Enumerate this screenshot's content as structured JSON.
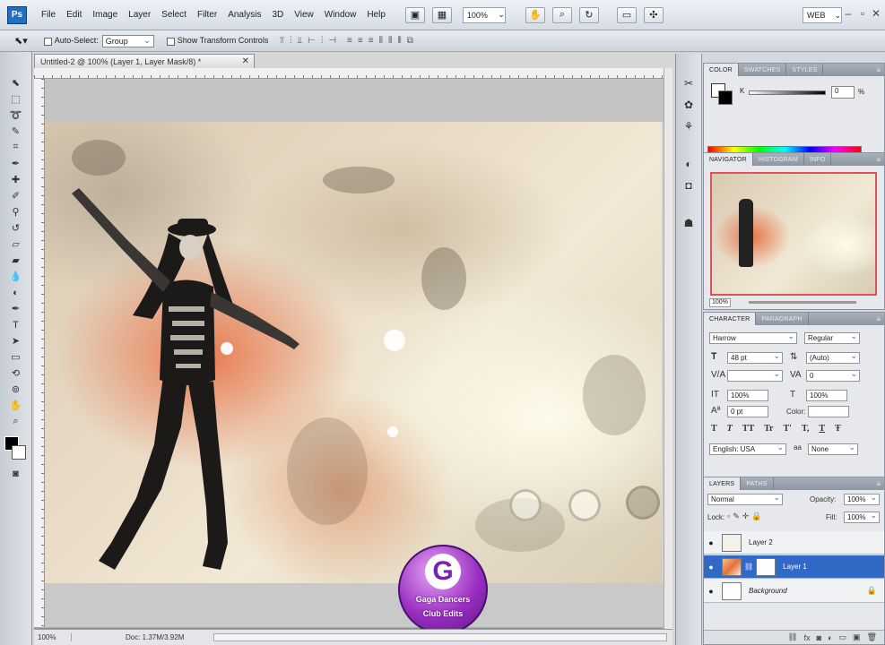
{
  "app": {
    "logo": "Ps",
    "menus": [
      "File",
      "Edit",
      "Image",
      "Layer",
      "Select",
      "Filter",
      "Analysis",
      "3D",
      "View",
      "Window",
      "Help"
    ],
    "zoom_select": "100%",
    "workspace": "WEB"
  },
  "options_bar": {
    "auto_select_label": "Auto-Select:",
    "auto_select_value": "Group",
    "show_transform_label": "Show Transform Controls"
  },
  "document": {
    "tab_title": "Untitled-2 @ 100% (Layer 1, Layer Mask/8) *",
    "status_zoom": "100%",
    "status_doc": "Doc: 1.37M/3.92M"
  },
  "watermark": {
    "letter": "G",
    "line1": "Gaga Dancers",
    "line2": "Club Edits"
  },
  "panels": {
    "color": {
      "tabs": [
        "COLOR",
        "SWATCHES",
        "STYLES"
      ],
      "k_label": "K",
      "k_value": "0",
      "k_unit": "%"
    },
    "navigator": {
      "tabs": [
        "NAVIGATOR",
        "HISTOGRAM",
        "INFO"
      ],
      "zoom": "100%"
    },
    "character": {
      "tabs": [
        "CHARACTER",
        "PARAGRAPH"
      ],
      "font_family": "Harrow",
      "font_style": "Regular",
      "font_size": "48 pt",
      "leading": "(Auto)",
      "kerning": "",
      "tracking": "0",
      "vertical_scale": "100%",
      "horizontal_scale": "100%",
      "baseline": "0 pt",
      "color_label": "Color:",
      "style_buttons": [
        "T",
        "T",
        "TT",
        "Tr",
        "T'",
        "T,",
        "T",
        "Ŧ"
      ],
      "language": "English: USA",
      "antialias": "None"
    },
    "layers": {
      "tabs": [
        "LAYERS",
        "PATHS"
      ],
      "blend_mode": "Normal",
      "opacity_label": "Opacity:",
      "opacity": "100%",
      "lock_label": "Lock:",
      "fill_label": "Fill:",
      "fill": "100%",
      "items": [
        {
          "name": "Layer 2",
          "selected": false
        },
        {
          "name": "Layer 1",
          "selected": true
        },
        {
          "name": "Background",
          "selected": false
        }
      ]
    }
  }
}
